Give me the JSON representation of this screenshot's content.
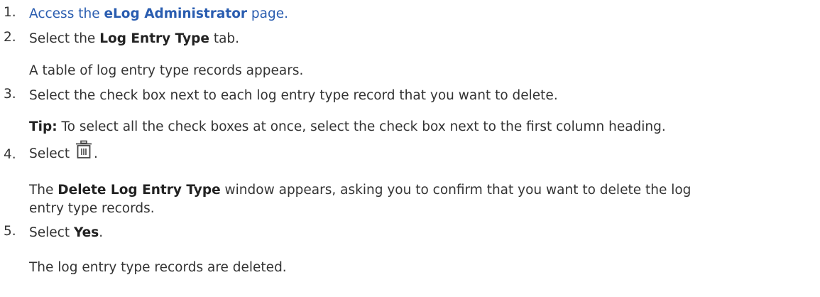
{
  "steps": [
    {
      "number": "1.",
      "pre": "Access the ",
      "link_bold": "eLog Administrator",
      "post": " page."
    },
    {
      "number": "2.",
      "pre": "Select the ",
      "bold": "Log Entry Type",
      "post": " tab.",
      "result": "A table of log entry type records appears."
    },
    {
      "number": "3.",
      "text": "Select the check box next to each log entry type record that you want to delete.",
      "tip_label": "Tip:",
      "tip_text": " To select all the check boxes at once, select the check box next to the first column heading."
    },
    {
      "number": "4.",
      "pre": "Select ",
      "icon": "trash-icon",
      "post": ".",
      "result_bold": "Delete Log Entry Type",
      "result_line1": " window appears, asking you to confirm that you want to delete the log",
      "result_line2": "entry type records.",
      "result_pre": "The "
    },
    {
      "number": "5.",
      "pre": "Select ",
      "bold": "Yes",
      "post": ".",
      "result": "The log entry type records are deleted."
    }
  ],
  "colors": {
    "text": "#333333",
    "link": "#2a5db0"
  }
}
